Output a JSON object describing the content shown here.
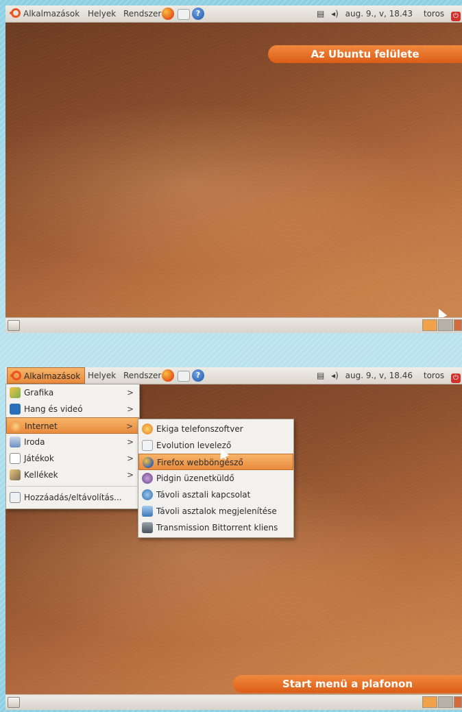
{
  "screen1": {
    "panel": {
      "menus": [
        "Alkalmazások",
        "Helyek",
        "Rendszer"
      ],
      "datetime": "aug. 9., v, 18.43",
      "user": "toros"
    },
    "banner": "Az Ubuntu felülete"
  },
  "screen2": {
    "panel": {
      "menus": [
        "Alkalmazások",
        "Helyek",
        "Rendszer"
      ],
      "datetime": "aug. 9., v, 18.46",
      "user": "toros"
    },
    "banner": "Start menü a plafonon",
    "applications_menu": {
      "items": [
        {
          "label": "Grafika",
          "icon": "graphics-icon"
        },
        {
          "label": "Hang és videó",
          "icon": "sound-video-icon"
        },
        {
          "label": "Internet",
          "icon": "internet-icon"
        },
        {
          "label": "Iroda",
          "icon": "office-icon"
        },
        {
          "label": "Játékok",
          "icon": "games-icon"
        },
        {
          "label": "Kellékek",
          "icon": "accessories-icon"
        }
      ],
      "footer": "Hozzáadás/eltávolítás...",
      "highlighted": "Internet"
    },
    "internet_submenu": {
      "items": [
        {
          "label": "Ekiga telefonszoftver",
          "icon": "ekiga-icon"
        },
        {
          "label": "Evolution levelező",
          "icon": "evolution-icon"
        },
        {
          "label": "Firefox webböngésző",
          "icon": "firefox-icon"
        },
        {
          "label": "Pidgin üzenetküldő",
          "icon": "pidgin-icon"
        },
        {
          "label": "Távoli asztali kapcsolat",
          "icon": "remote-desktop-icon"
        },
        {
          "label": "Távoli asztalok megjelenítése",
          "icon": "remote-viewer-icon"
        },
        {
          "label": "Transmission Bittorrent kliens",
          "icon": "transmission-icon"
        }
      ],
      "highlighted": "Firefox webböngésző"
    }
  },
  "colors": {
    "accent_orange": "#e95420",
    "banner": "#e46a24",
    "panel": "#e3ded6",
    "desktop": "#8a4e2c"
  }
}
